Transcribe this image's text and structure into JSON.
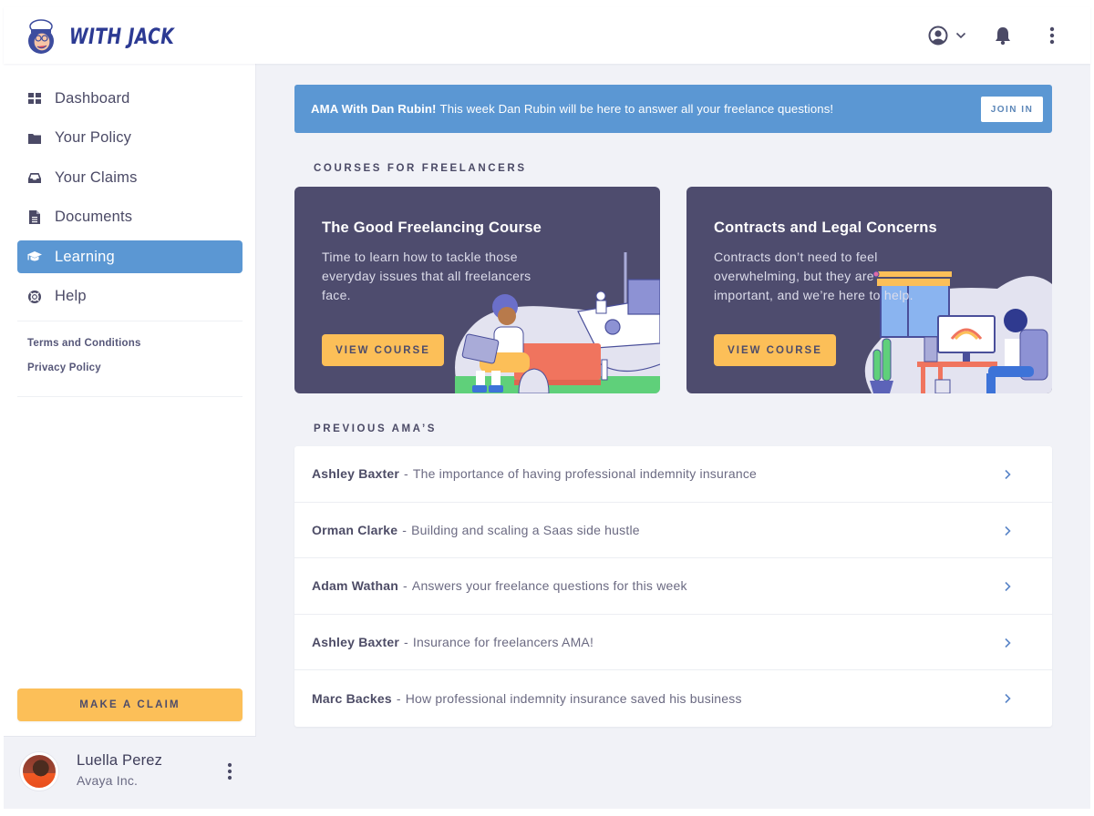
{
  "brand": {
    "name": "WITH JACK",
    "accent": "#5b97d3",
    "cta": "#fcbf58",
    "dark_card": "#4e4c6e"
  },
  "topbar": {
    "icons": [
      "user-circle-icon",
      "chevron-down-icon",
      "bell-icon",
      "kebab-icon"
    ]
  },
  "sidebar": {
    "items": [
      {
        "label": "Dashboard",
        "icon": "grid-icon",
        "active": false
      },
      {
        "label": "Your Policy",
        "icon": "folder-icon",
        "active": false
      },
      {
        "label": "Your Claims",
        "icon": "inbox-icon",
        "active": false
      },
      {
        "label": "Documents",
        "icon": "document-icon",
        "active": false
      },
      {
        "label": "Learning",
        "icon": "graduation-cap-icon",
        "active": true
      },
      {
        "label": "Help",
        "icon": "lifebuoy-icon",
        "active": false
      }
    ],
    "legal_links": [
      "Terms and Conditions",
      "Privacy Policy"
    ],
    "make_claim_label": "MAKE A CLAIM",
    "profile": {
      "name": "Luella Perez",
      "company": "Avaya Inc."
    }
  },
  "banner": {
    "title": "AMA With Dan Rubin!",
    "message": "This week Dan Rubin will be here to answer all your freelance questions!",
    "button_label": "JOIN IN"
  },
  "courses": {
    "section_title": "COURSES FOR FREELANCERS",
    "items": [
      {
        "title": "The Good Freelancing Course",
        "description": "Time to learn how to tackle those everyday issues that all freelancers face.",
        "button_label": "VIEW COURSE"
      },
      {
        "title": "Contracts and Legal Concerns",
        "description": "Contracts don’t need to feel overwhelming, but they are important, and we’re here to help.",
        "button_label": "VIEW COURSE"
      }
    ]
  },
  "amas": {
    "section_title": "PREVIOUS AMA’S",
    "separator": "-",
    "items": [
      {
        "name": "Ashley Baxter",
        "topic": "The importance of having professional indemnity insurance"
      },
      {
        "name": "Orman Clarke",
        "topic": "Building and scaling a Saas side hustle"
      },
      {
        "name": "Adam Wathan",
        "topic": "Answers your freelance questions for this week"
      },
      {
        "name": "Ashley Baxter",
        "topic": "Insurance for freelancers AMA!"
      },
      {
        "name": "Marc Backes",
        "topic": "How professional indemnity insurance saved his business"
      }
    ]
  }
}
